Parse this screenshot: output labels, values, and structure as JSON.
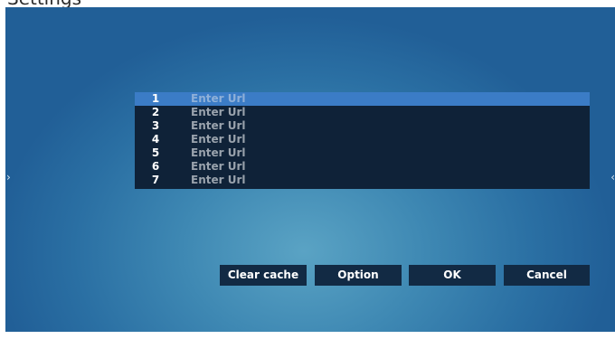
{
  "header": {
    "title": "Settings"
  },
  "navigation": {
    "left_arrow": "›",
    "right_arrow": "‹"
  },
  "url_list": {
    "rows": [
      {
        "number": "1",
        "placeholder": "Enter Url",
        "selected": true
      },
      {
        "number": "2",
        "placeholder": "Enter Url"
      },
      {
        "number": "3",
        "placeholder": "Enter Url"
      },
      {
        "number": "4",
        "placeholder": "Enter Url"
      },
      {
        "number": "5",
        "placeholder": "Enter Url"
      },
      {
        "number": "6",
        "placeholder": "Enter Url"
      },
      {
        "number": "7",
        "placeholder": "Enter Url"
      }
    ]
  },
  "buttons": {
    "clear_cache": "Clear cache",
    "option": "Option",
    "ok": "OK",
    "cancel": "Cancel"
  },
  "colors": {
    "background_center": "#5aa3c4",
    "background_edge": "#215f97",
    "list_background": "#0f2238",
    "selected_row": "#3b7cc6",
    "button_background": "#122a44"
  }
}
